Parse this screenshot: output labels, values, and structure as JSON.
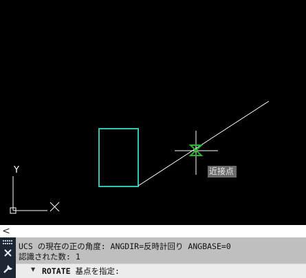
{
  "canvas": {
    "tooltip": "近接点",
    "ucs_y_label": "Y"
  },
  "scrollbar": {
    "left_arrow": "<"
  },
  "command_line": {
    "history": [
      "UCS の現在の正の角度:  ANGDIR=反時計回り  ANGBASE=0",
      "認識された数: 1"
    ],
    "prompt_command": "ROTATE",
    "prompt_text": " 基点を指定:"
  },
  "colors": {
    "background": "#000000",
    "rectangle_outline": "#34c3b0",
    "rectangle_inner": "#2e72a8",
    "snap_marker": "#29b82d",
    "crosshair": "#ffffff"
  }
}
